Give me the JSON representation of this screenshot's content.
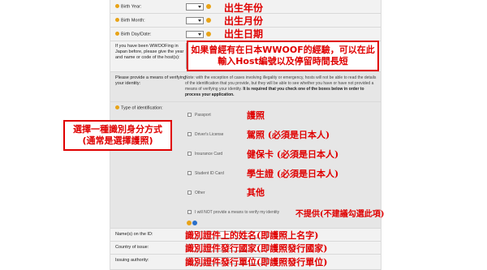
{
  "birth": {
    "year_label": "Birth Year:",
    "month_label": "Birth Month:",
    "day_label": "Birth Day/Date:",
    "year_note": "出生年份",
    "month_note": "出生月份",
    "day_note": "出生日期"
  },
  "host": {
    "label": "If you have been WWOOFing in Japan before, please give the year and name or code of the host(s):",
    "callout": "如果曾經有在日本WWOOF的經驗，可以在此輸入Host編號以及停留時間長短"
  },
  "verify": {
    "label": "Please provide a means of verifying your identity:",
    "note_plain": "Note: with the exception of cases involving illegality or emergency, hosts will not be able to read the details of the identification that you provide, but they will be able to see whether you have or have not provided a means of verifying your identity. ",
    "note_bold": "It is required that you check one of the boxes below in order to process your application."
  },
  "id_type": {
    "label": "Type of identification:",
    "callout": "選擇一種識別身分方式\n(通常是選擇護照)",
    "options": [
      {
        "label": "Passport",
        "note": "護照"
      },
      {
        "label": "Driver's License",
        "note": "駕照 (必須是日本人)"
      },
      {
        "label": "Insurance Card",
        "note": "健保卡 (必須是日本人)"
      },
      {
        "label": "Student ID Card",
        "note": "學生證 (必須是日本人)"
      },
      {
        "label": "Other",
        "note": "其他"
      },
      {
        "label": "I will NOT provide a means to verify my identity",
        "note": "不提供(不建議勾選此項)"
      }
    ]
  },
  "fields": {
    "names_label": "Name(s) on the ID:",
    "names_note": "識別證件上的姓名(即護照上名字)",
    "country_label": "Country of issue:",
    "country_note": "識別證件發行國家(即護照發行國家)",
    "authority_label": "Issuing authority:",
    "authority_note": "識別證件發行單位(即護照發行單位)"
  }
}
